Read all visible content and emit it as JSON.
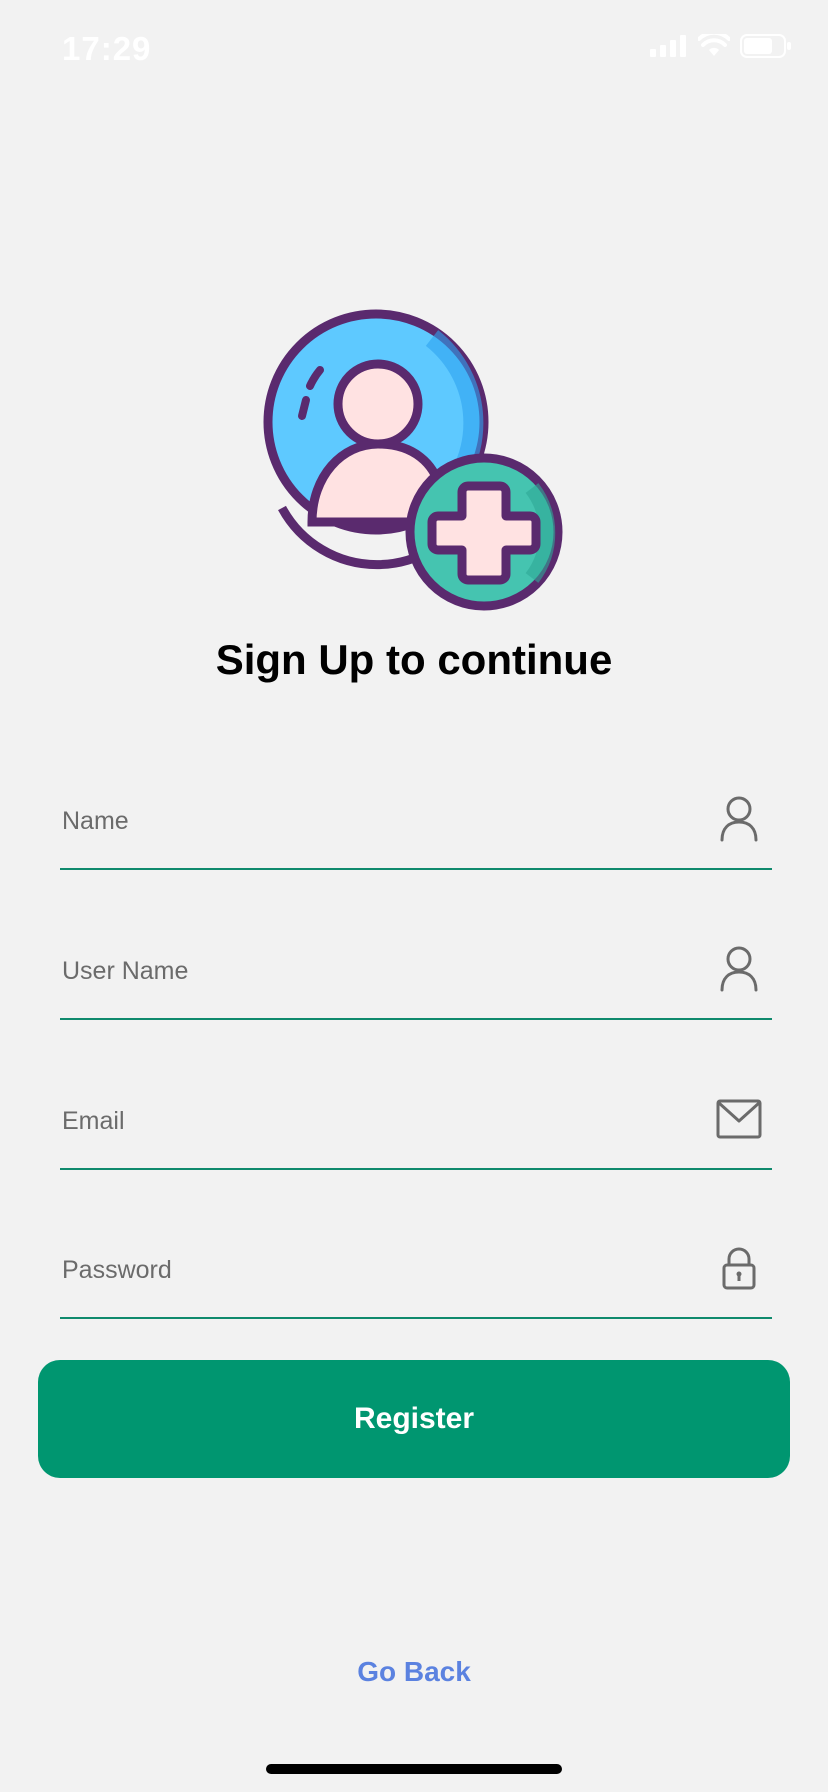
{
  "status_bar": {
    "time": "17:29",
    "signal_icon": "cellular-signal-icon",
    "wifi_icon": "wifi-icon",
    "battery_icon": "battery-icon"
  },
  "hero": {
    "icon": "add-user-illustration"
  },
  "title": "Sign Up to continue",
  "form": {
    "name": {
      "placeholder": "Name",
      "value": "",
      "icon": "person-icon"
    },
    "username": {
      "placeholder": "User Name",
      "value": "",
      "icon": "person-icon"
    },
    "email": {
      "placeholder": "Email",
      "value": "",
      "icon": "mail-icon"
    },
    "password": {
      "placeholder": "Password",
      "value": "",
      "icon": "lock-icon"
    }
  },
  "register_label": "Register",
  "go_back_label": "Go Back",
  "colors": {
    "background": "#f2f2f2",
    "accent": "#009670",
    "field_underline": "#0f8a6d",
    "link": "#5b82e0"
  }
}
